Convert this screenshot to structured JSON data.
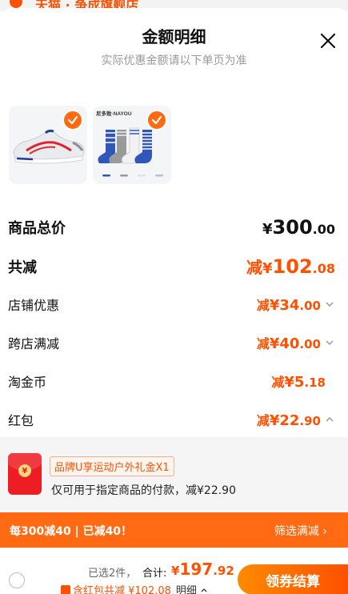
{
  "background_peek": {
    "text": "天猫 · 争成旗舰店"
  },
  "sheet": {
    "title": "金额明细",
    "subtitle": "实际优惠金额请以下单页为准"
  },
  "products": [
    {
      "name": "sneaker",
      "checked": true
    },
    {
      "name": "socks",
      "brand_text": "尼多致·NAYOU",
      "checked": true
    }
  ],
  "breakdown": {
    "total": {
      "label": "商品总价",
      "yen": "¥",
      "int": "300",
      "dec": ".00"
    },
    "reduction": {
      "label": "共减",
      "prefix": "减",
      "yen": "¥",
      "int": "102",
      "dec": ".08"
    },
    "shop_discount": {
      "label": "店铺优惠",
      "prefix": "减",
      "yen": "¥",
      "int": "34",
      "dec": ".00"
    },
    "cross_store": {
      "label": "跨店满减",
      "prefix": "减",
      "yen": "¥",
      "int": "40",
      "dec": ".00"
    },
    "taojinbi": {
      "label": "淘金币",
      "prefix": "减",
      "yen": "¥",
      "int": "5",
      "dec": ".18"
    },
    "red_packet": {
      "label": "红包",
      "prefix": "减",
      "yen": "¥",
      "int": "22",
      "dec": ".90"
    }
  },
  "red_packet_detail": {
    "coin_glyph": "¥",
    "tag": "品牌U享运动户外礼金X1",
    "description": "仅可用于指定商品的付款，减¥22.90"
  },
  "promo_bar": {
    "left": "每300减40 | 已减40！",
    "right": "筛选满减"
  },
  "checkout": {
    "selected": "已选2件，",
    "total_label": "合计:",
    "total_yen": "¥",
    "total_int": "197",
    "total_dec": ".92",
    "discount_text": "含红包共减 ¥102.08",
    "detail_label": "明细",
    "button": "领券结算"
  },
  "colors": {
    "accent": "#ff5000",
    "accent_light": "#ff6a13"
  }
}
